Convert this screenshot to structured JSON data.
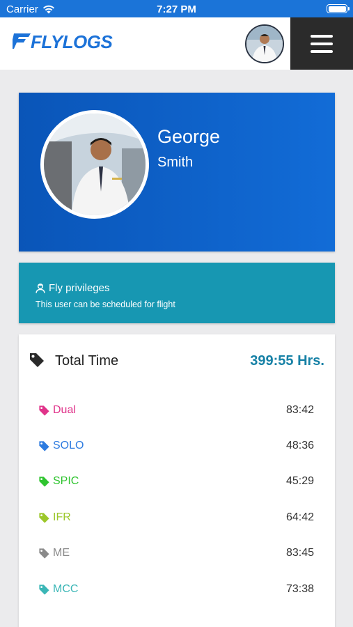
{
  "status_bar": {
    "carrier": "Carrier",
    "time": "7:27 PM"
  },
  "header": {
    "logo_text": "FLYLOGS",
    "menu_icon": "hamburger-menu-icon"
  },
  "profile": {
    "first_name": "George",
    "last_name": "Smith"
  },
  "privileges": {
    "title": "Fly privileges",
    "subtitle": "This user can be scheduled for flight"
  },
  "total_time": {
    "label": "Total Time",
    "value": "399:55 Hrs."
  },
  "time_rows": [
    {
      "name": "Dual",
      "value": "83:42",
      "color": "#e0338a"
    },
    {
      "name": "SOLO",
      "value": "48:36",
      "color": "#2d7be0"
    },
    {
      "name": "SPIC",
      "value": "45:29",
      "color": "#2fc42f"
    },
    {
      "name": "IFR",
      "value": "64:42",
      "color": "#9cc72a"
    },
    {
      "name": "ME",
      "value": "83:45",
      "color": "#8a8a8a"
    },
    {
      "name": "MCC",
      "value": "73:38",
      "color": "#3ab6b6"
    }
  ],
  "colors": {
    "status_bar": "#1b74d8",
    "profile_card": "#0d5ec4",
    "privileges_card": "#1797b2",
    "total_value": "#1781a6",
    "menu_bg": "#2b2b2b"
  }
}
